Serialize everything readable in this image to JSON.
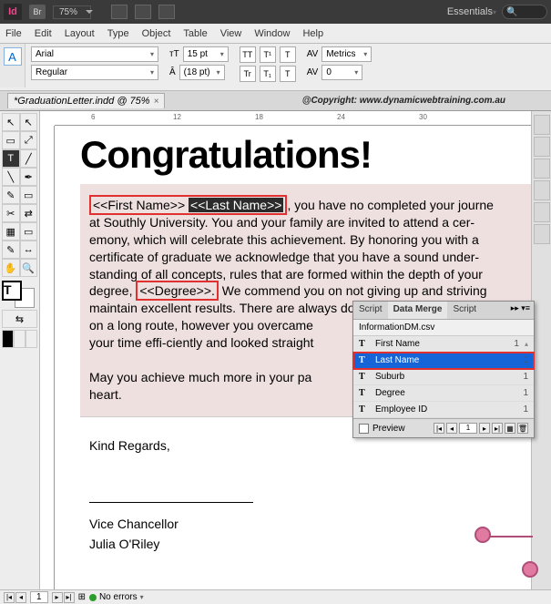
{
  "titlebar": {
    "app_logo": "Id",
    "br_badge": "Br",
    "zoom": "75%",
    "workspace": "Essentials"
  },
  "menu": {
    "file": "File",
    "edit": "Edit",
    "layout": "Layout",
    "type": "Type",
    "object": "Object",
    "table": "Table",
    "view": "View",
    "window": "Window",
    "help": "Help"
  },
  "ctrl": {
    "char": "A",
    "font_family": "Arial",
    "font_style": "Regular",
    "size_icon": "T",
    "size": "15 pt",
    "leading_icon": "A",
    "leading": "(18 pt)",
    "tt1": "TT",
    "tt2": "T¹",
    "tt3": "T",
    "tr1": "Tr",
    "tr2": "T₁",
    "tr3": "T",
    "kern_icon": "AV",
    "kern": "Metrics",
    "track_icon": "AV",
    "track": "0"
  },
  "tab": {
    "title": "*GraduationLetter.indd @ 75%",
    "copyright": "@Copyright: www.dynamicwebtraining.com.au"
  },
  "ruler_marks": [
    "6",
    "12",
    "18",
    "24",
    "30"
  ],
  "doc": {
    "headline": "Congratulations!",
    "field_first": "<<First Name>>",
    "field_last": "<<Last Name>>",
    "para1a": ", you have no completed your journe",
    "para1b": "at Southly University. You and your family are invited to attend a cer-",
    "para1c": "emony, which will celebrate this achievement. By honoring you with a",
    "para1d": "certificate of graduate we acknowledge that you have a sound under-",
    "para1e": "standing of all concepts, rules that are formed within the depth of your",
    "para1f_pre": "degree, ",
    "field_degree": "<<Degree>>.",
    "para1f_post": " We commend you on not giving up and striving",
    "para1g": "maintain excellent results. There are always downfalls when one start",
    "para1h": "on a long route, however you overcame",
    "para1i": "your time effi-ciently and looked straight",
    "para2a": "May you achieve much more in your pa",
    "para2b": "heart.",
    "kind_regards": "Kind Regards,",
    "title1": "Vice Chancellor",
    "title2": "Julia O'Riley"
  },
  "toolbox": {
    "arrow": "↖",
    "direct": "↖",
    "page": "▭",
    "gap": "⤢",
    "type": "T",
    "typepath": "╱",
    "line": "╲",
    "pen": "✒",
    "pencil": "✎",
    "rect": "▭",
    "scissors": "✂",
    "swap": "⇄",
    "grad": "▦",
    "note": "▭",
    "eyedrop": "✎",
    "measure": "↔",
    "hand": "✋",
    "zoom": "🔍",
    "bigT": "T",
    "arrowT": "⇆",
    "modes": [
      "■",
      "□",
      "▧"
    ]
  },
  "data_merge": {
    "tabs": [
      "Script",
      "Data Merge",
      "Script"
    ],
    "source_file": "InformationDM.csv",
    "fields": [
      {
        "label": "First Name",
        "count": "1"
      },
      {
        "label": "Last Name",
        "count": "1"
      },
      {
        "label": "Suburb",
        "count": "1"
      },
      {
        "label": "Degree",
        "count": "1"
      },
      {
        "label": "Employee ID",
        "count": "1"
      }
    ],
    "preview_label": "Preview",
    "page": "1"
  },
  "status": {
    "page_field": "1",
    "no_errors": "No errors"
  }
}
